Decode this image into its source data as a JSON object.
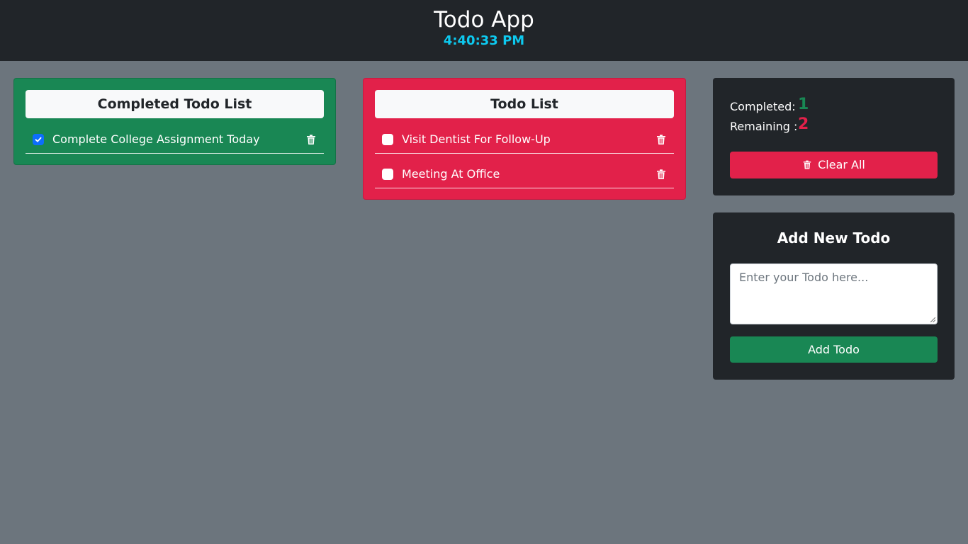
{
  "header": {
    "title": "Todo App",
    "clock": "4:40:33 PM"
  },
  "completed_list": {
    "title": "Completed Todo List",
    "items": [
      {
        "text": "Complete College Assignment Today",
        "checked": true
      }
    ]
  },
  "todo_list": {
    "title": "Todo List",
    "items": [
      {
        "text": "Visit Dentist For Follow-Up",
        "checked": false
      },
      {
        "text": "Meeting At Office",
        "checked": false
      }
    ]
  },
  "stats": {
    "completed_label": "Completed:",
    "completed_count": "1",
    "remaining_label": "Remaining :",
    "remaining_count": "2",
    "clear_label": "Clear All"
  },
  "add_form": {
    "title": "Add New Todo",
    "placeholder": "Enter your Todo here...",
    "value": "",
    "button_label": "Add Todo"
  },
  "colors": {
    "background": "#6c757d",
    "header": "#212529",
    "clock": "#0dcaf0",
    "completed_panel": "#198754",
    "todo_panel": "#e2214a",
    "completed_count": "#198754",
    "remaining_count": "#e2214a"
  },
  "icons": {
    "trash": "trash-icon",
    "check": "check-icon"
  }
}
